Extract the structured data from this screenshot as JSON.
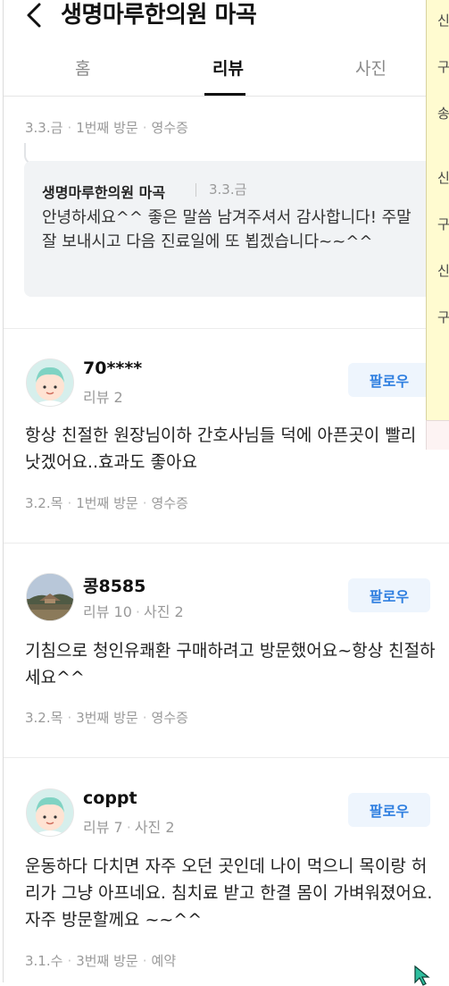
{
  "header": {
    "title": "생명마루한의원 마곡",
    "tabs": [
      "홈",
      "리뷰",
      "사진"
    ],
    "active_tab": "리뷰"
  },
  "review0": {
    "date": "3.3.금",
    "visit": "1번째 방문",
    "proof": "영수증"
  },
  "reply": {
    "author": "생명마루한의원 마곡",
    "date": "3.3.금",
    "text": "안녕하세요^^ 좋은 말씀 남겨주셔서 감사합니다! 주말 잘 보내시고 다음 진료일에 또 뵙겠습니다~~^^"
  },
  "reviews": [
    {
      "name": "70****",
      "stats": [
        "리뷰 2"
      ],
      "follow": "팔로우",
      "text": "항상 친절한 원장님이하 간호사님들 덕에 아픈곳이 빨리 낫겠어요..효과도 좋아요",
      "date": "3.2.목",
      "visit": "1번째 방문",
      "proof": "영수증"
    },
    {
      "name": "콩8585",
      "stats": [
        "리뷰 10",
        "사진 2"
      ],
      "follow": "팔로우",
      "text": "기침으로 청인유쾌환 구매하려고 방문했어요~항상 친절하세요^^",
      "date": "3.2.목",
      "visit": "3번째 방문",
      "proof": "영수증"
    },
    {
      "name": "coppt",
      "stats": [
        "리뷰 7",
        "사진 2"
      ],
      "follow": "팔로우",
      "text": "운동하다 다치면 자주 오던 곳인데 나이 먹으니 목이랑 허리가 그냥 아프네요. 침치료 받고 한결 몸이 가벼워졌어요. 자주 방문할께요 ~~^^",
      "date": "3.1.수",
      "visit": "3번째 방문",
      "proof": "예약"
    }
  ],
  "side_panel": {
    "chars": [
      "신",
      "구",
      "송",
      "신",
      "구",
      "신",
      "구"
    ]
  },
  "colors": {
    "accent": "#2f7fe0",
    "follow_bg": "#eef5fd",
    "reply_bg": "#f1f3f5",
    "side_panel": "#fffbd0"
  }
}
